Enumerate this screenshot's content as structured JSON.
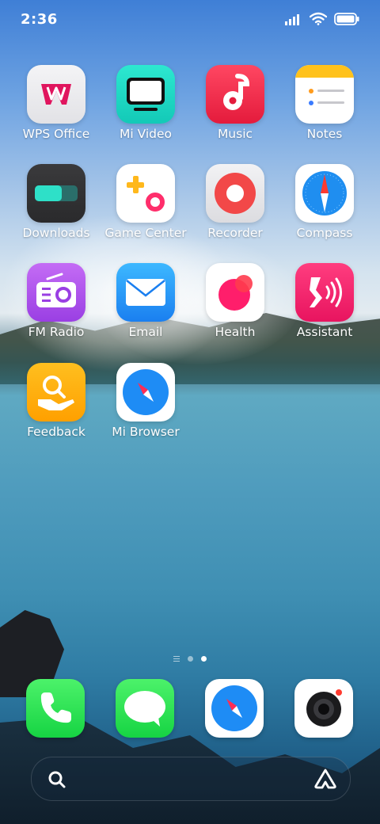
{
  "status_bar": {
    "time": "2:36"
  },
  "apps": [
    {
      "label": "WPS Office"
    },
    {
      "label": "Mi Video"
    },
    {
      "label": "Music"
    },
    {
      "label": "Notes"
    },
    {
      "label": "Downloads"
    },
    {
      "label": "Game Center"
    },
    {
      "label": "Recorder"
    },
    {
      "label": "Compass"
    },
    {
      "label": "FM Radio"
    },
    {
      "label": "Email"
    },
    {
      "label": "Health"
    },
    {
      "label": "Assistant"
    },
    {
      "label": "Feedback"
    },
    {
      "label": "Mi Browser"
    }
  ],
  "page_indicator": {
    "pages": 2,
    "current": 2
  },
  "dock": [
    "phone-icon",
    "messages-icon",
    "browser-icon",
    "camera-icon"
  ],
  "search": {
    "left_icon": "search-icon",
    "right_icon": "assistant-icon"
  }
}
